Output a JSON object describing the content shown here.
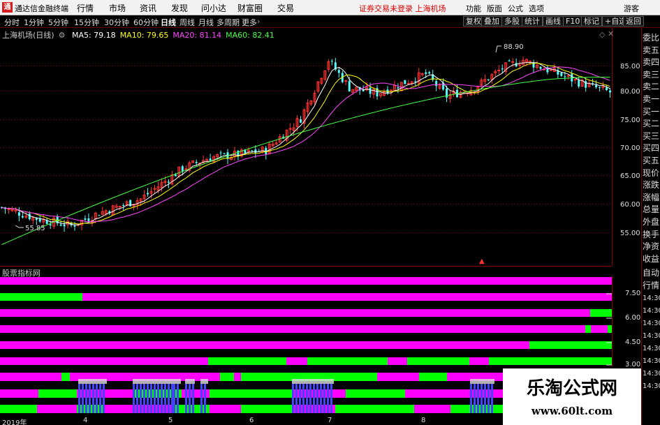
{
  "menubar": {
    "app_title": "通达信金融终端",
    "logo_glyph": "通",
    "items": [
      "行情",
      "市场",
      "资讯",
      "发现",
      "问小达",
      "财富圈",
      "交易"
    ],
    "notice": "证券交易未登录  上海机场",
    "right_items": [
      "功能",
      "版面",
      "公式",
      "选项"
    ],
    "guest": "游客"
  },
  "toolbar": {
    "periods": [
      "分时",
      "1分钟",
      "5分钟",
      "15分钟",
      "30分钟",
      "60分钟",
      "日线",
      "周线",
      "月线",
      "多周期",
      "更多"
    ],
    "active_period": "日线",
    "buttons": [
      "复权",
      "叠加",
      "多股",
      "统计",
      "画线",
      "F10",
      "标记",
      "+自选",
      "返回"
    ]
  },
  "chart": {
    "title": "上海机场(日线)",
    "ma_labels": [
      {
        "text": "MA5: 79.18",
        "color": "#ffffff"
      },
      {
        "text": "MA10: 79.65",
        "color": "#ffff00"
      },
      {
        "text": "MA20: 81.14",
        "color": "#ff44ff"
      },
      {
        "text": "MA60: 82.41",
        "color": "#44ff44"
      }
    ],
    "high_label": "88.90",
    "low_label": "55.85",
    "price_ticks": [
      "85.00",
      "80.00",
      "75.00",
      "70.00",
      "65.00",
      "60.00",
      "55.00"
    ],
    "up_color": "#ff3232",
    "down_color": "#54fcfc",
    "grid_color": "#800000"
  },
  "side_panel": {
    "items": [
      "委比",
      "卖五",
      "卖四",
      "卖三",
      "卖二",
      "卖一",
      "买一",
      "买二",
      "买三",
      "买四",
      "买五",
      "现价",
      "涨跌",
      "涨幅",
      "总量",
      "外盘",
      "换手",
      "净资",
      "收益"
    ],
    "lower_items": [
      "自动",
      "行情",
      "14:30",
      "14:30",
      "14:30",
      "14:30",
      "14:30",
      "14:30",
      "14:30",
      "14:30"
    ]
  },
  "indicator": {
    "title": "股票指标网",
    "ticks": [
      "7.50",
      "6.00",
      "4.50",
      "3.00"
    ],
    "magenta": "#ff00ff",
    "green": "#00ff00",
    "blue": "#4444ff"
  },
  "date_axis": {
    "labels": [
      "2019年",
      "4",
      "5",
      "6",
      "7",
      "8"
    ]
  },
  "watermark": {
    "title": "乐淘公式网",
    "url": "www.60lt.com"
  }
}
